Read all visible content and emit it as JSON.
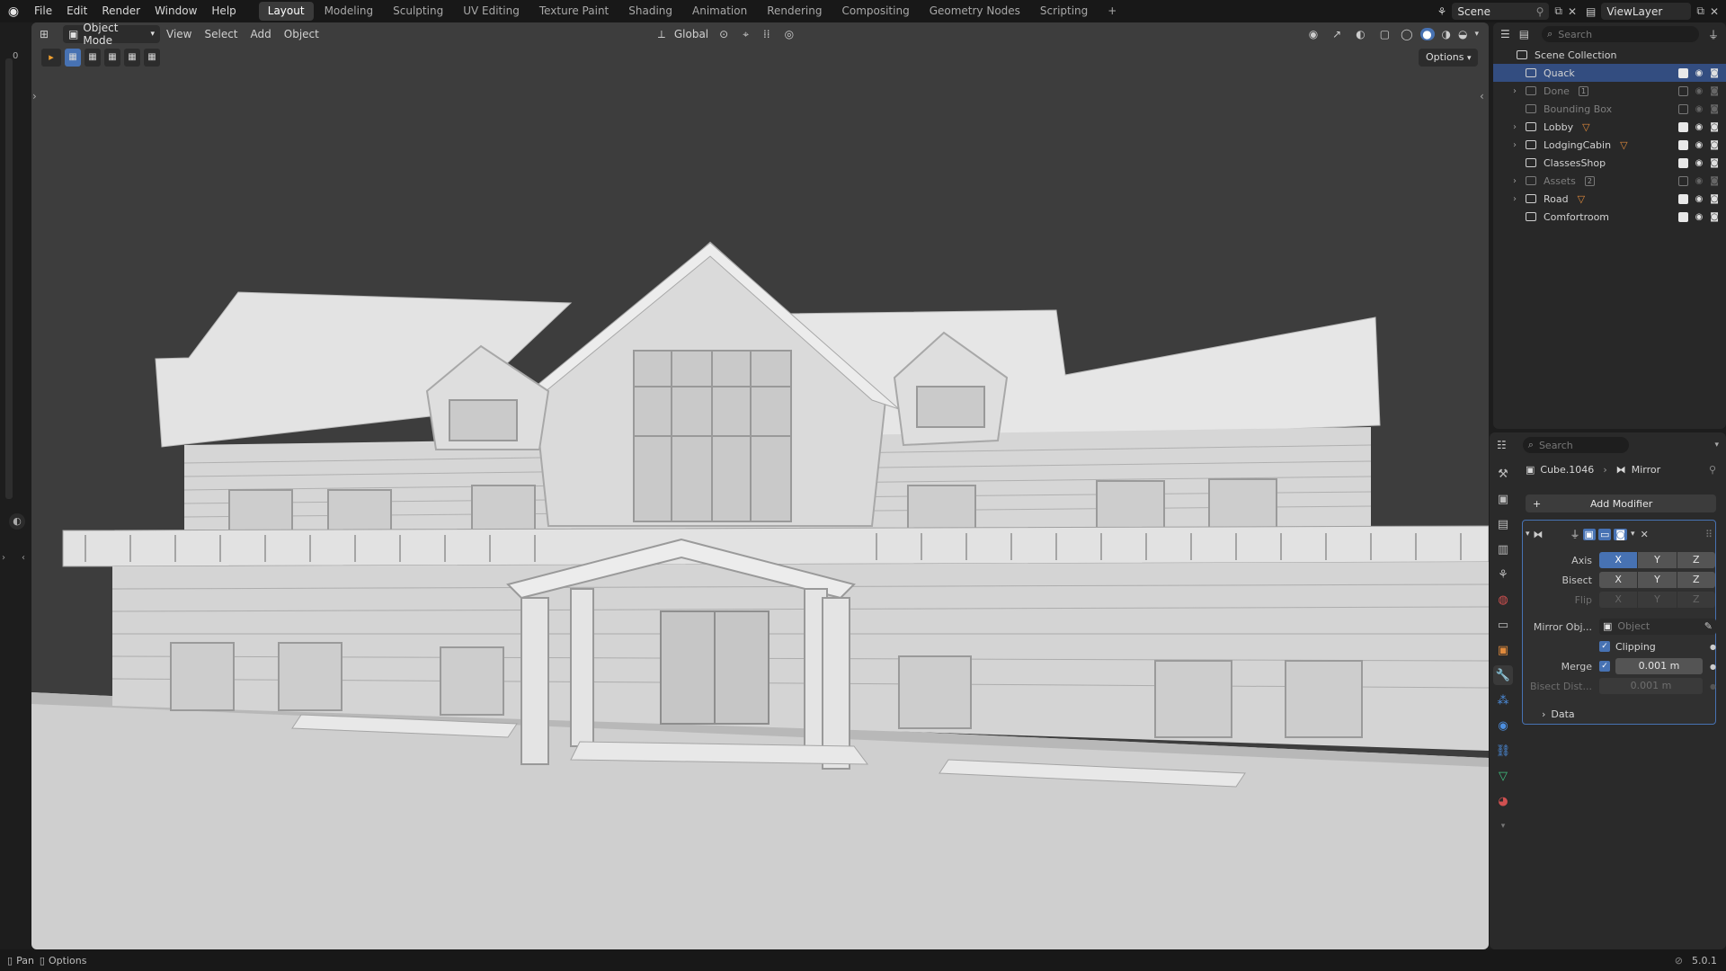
{
  "topbar": {
    "menus": [
      "File",
      "Edit",
      "Render",
      "Window",
      "Help"
    ],
    "workspaces": [
      "Layout",
      "Modeling",
      "Sculpting",
      "UV Editing",
      "Texture Paint",
      "Shading",
      "Animation",
      "Rendering",
      "Compositing",
      "Geometry Nodes",
      "Scripting"
    ],
    "active_workspace": "Layout",
    "add_tab": "+",
    "scene": "Scene",
    "view_layer": "ViewLayer"
  },
  "viewport": {
    "mode": "Object Mode",
    "menus": [
      "View",
      "Select",
      "Add",
      "Object"
    ],
    "transform_orientation": "Global",
    "options": "Options",
    "frame_indicator": "0"
  },
  "outliner": {
    "search_placeholder": "Search",
    "root": "Scene Collection",
    "items": [
      {
        "label": "Quack",
        "state": "selected",
        "badge": ""
      },
      {
        "label": "Done",
        "state": "hidden",
        "badge": "1"
      },
      {
        "label": "Bounding Box",
        "state": "hidden",
        "badge": ""
      },
      {
        "label": "Lobby",
        "state": "visible",
        "badge": ""
      },
      {
        "label": "LodgingCabin",
        "state": "visible",
        "badge": ""
      },
      {
        "label": "ClassesShop",
        "state": "visible",
        "badge": ""
      },
      {
        "label": "Assets",
        "state": "hidden",
        "badge": "2"
      },
      {
        "label": "Road",
        "state": "visible",
        "badge": ""
      },
      {
        "label": "Comfortroom",
        "state": "visible",
        "badge": ""
      }
    ]
  },
  "properties": {
    "search_placeholder": "Search",
    "object": "Cube.1046",
    "modifier": "Mirror",
    "add_modifier": "Add Modifier",
    "axis_label": "Axis",
    "bisect_label": "Bisect",
    "flip_label": "Flip",
    "axes": [
      "X",
      "Y",
      "Z"
    ],
    "mirror_object_label": "Mirror Obj...",
    "mirror_object_placeholder": "Object",
    "clipping_label": "Clipping",
    "merge_label": "Merge",
    "merge_value": "0.001 m",
    "bisect_distance_label": "Bisect Dist...",
    "bisect_distance_value": "0.001 m",
    "data_label": "Data"
  },
  "statusbar": {
    "pan": "Pan",
    "options": "Options",
    "version": "5.0.1"
  },
  "colors": {
    "accent": "#4772b3",
    "selection": "#334d80",
    "orange": "#e08a3c"
  }
}
